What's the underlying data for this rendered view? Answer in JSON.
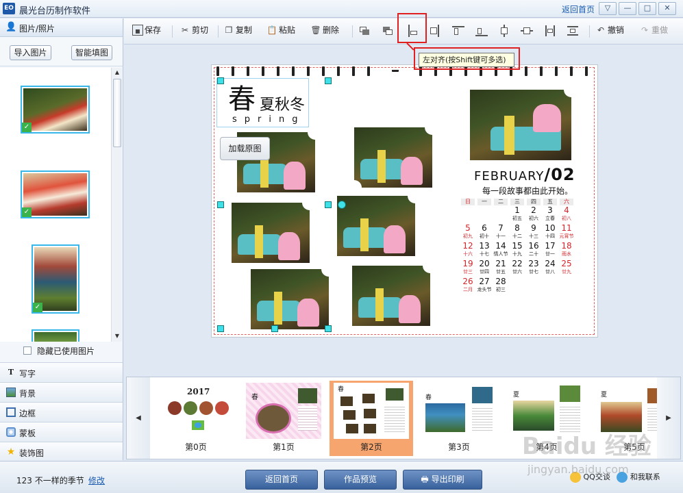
{
  "window": {
    "logo": "EO",
    "title": "晨光台历制作软件",
    "back_home": "返回首页",
    "menu_glyph": "▽",
    "minimize_glyph": "—",
    "maximize_glyph": "□",
    "close_glyph": "✕"
  },
  "sidebar": {
    "header_label": "图片/照片",
    "import_button": "导入图片",
    "smart_fill_button": "智能填图",
    "hide_used_label": "隐藏已使用图片",
    "tools": [
      {
        "label": "写字",
        "icon": "text-tool-icon"
      },
      {
        "label": "背景",
        "icon": "background-icon"
      },
      {
        "label": "边框",
        "icon": "border-icon"
      },
      {
        "label": "蒙板",
        "icon": "mask-icon"
      },
      {
        "label": "装饰图",
        "icon": "decoration-star-icon"
      }
    ]
  },
  "toolbar": {
    "save": "保存",
    "cut": "剪切",
    "copy": "复制",
    "paste": "粘贴",
    "delete": "删除",
    "undo": "撤销",
    "redo": "重做",
    "tooltip": "左对齐(按Shift键可多选)"
  },
  "calendar_page": {
    "title_big": "春",
    "title_rest": "夏秋冬",
    "title_en": "spring",
    "load_original": "加载原图",
    "month_title": "FEBRUARY",
    "month_num": "/02",
    "tagline": "每一段故事都由此开始。",
    "weekdays": [
      "日",
      "一",
      "二",
      "三",
      "四",
      "五",
      "六"
    ],
    "days": [
      {
        "n": "1",
        "l": "初五",
        "col": 3,
        "row": 0,
        "red": false
      },
      {
        "n": "2",
        "l": "初六",
        "col": 4,
        "row": 0,
        "red": false
      },
      {
        "n": "3",
        "l": "立春",
        "col": 5,
        "row": 0,
        "red": false
      },
      {
        "n": "4",
        "l": "初八",
        "col": 6,
        "row": 0,
        "red": true
      },
      {
        "n": "5",
        "l": "初九",
        "col": 0,
        "row": 1,
        "red": true
      },
      {
        "n": "6",
        "l": "初十",
        "col": 1,
        "row": 1,
        "red": false
      },
      {
        "n": "7",
        "l": "十一",
        "col": 2,
        "row": 1,
        "red": false
      },
      {
        "n": "8",
        "l": "十二",
        "col": 3,
        "row": 1,
        "red": false
      },
      {
        "n": "9",
        "l": "十三",
        "col": 4,
        "row": 1,
        "red": false
      },
      {
        "n": "10",
        "l": "十四",
        "col": 5,
        "row": 1,
        "red": false
      },
      {
        "n": "11",
        "l": "元宵节",
        "col": 6,
        "row": 1,
        "red": true
      },
      {
        "n": "12",
        "l": "十六",
        "col": 0,
        "row": 2,
        "red": true
      },
      {
        "n": "13",
        "l": "十七",
        "col": 1,
        "row": 2,
        "red": false
      },
      {
        "n": "14",
        "l": "情人节",
        "col": 2,
        "row": 2,
        "red": false
      },
      {
        "n": "15",
        "l": "十九",
        "col": 3,
        "row": 2,
        "red": false
      },
      {
        "n": "16",
        "l": "二十",
        "col": 4,
        "row": 2,
        "red": false
      },
      {
        "n": "17",
        "l": "廿一",
        "col": 5,
        "row": 2,
        "red": false
      },
      {
        "n": "18",
        "l": "雨水",
        "col": 6,
        "row": 2,
        "red": true
      },
      {
        "n": "19",
        "l": "廿三",
        "col": 0,
        "row": 3,
        "red": true
      },
      {
        "n": "20",
        "l": "廿四",
        "col": 1,
        "row": 3,
        "red": false
      },
      {
        "n": "21",
        "l": "廿五",
        "col": 2,
        "row": 3,
        "red": false
      },
      {
        "n": "22",
        "l": "廿六",
        "col": 3,
        "row": 3,
        "red": false
      },
      {
        "n": "23",
        "l": "廿七",
        "col": 4,
        "row": 3,
        "red": false
      },
      {
        "n": "24",
        "l": "廿八",
        "col": 5,
        "row": 3,
        "red": false
      },
      {
        "n": "25",
        "l": "廿九",
        "col": 6,
        "row": 3,
        "red": true
      },
      {
        "n": "26",
        "l": "二月",
        "col": 0,
        "row": 4,
        "red": true
      },
      {
        "n": "27",
        "l": "龙头节",
        "col": 1,
        "row": 4,
        "red": false
      },
      {
        "n": "28",
        "l": "初三",
        "col": 2,
        "row": 4,
        "red": false
      }
    ]
  },
  "page_strip": {
    "pages": [
      {
        "label": "第0页",
        "heading": "2017",
        "active": false
      },
      {
        "label": "第1页",
        "heading": "春",
        "active": false
      },
      {
        "label": "第2页",
        "heading": "春",
        "active": true
      },
      {
        "label": "第3页",
        "heading": "春",
        "active": false
      },
      {
        "label": "第4页",
        "heading": "夏",
        "active": false
      },
      {
        "label": "第5页",
        "heading": "夏",
        "active": false
      }
    ]
  },
  "bottombar": {
    "project_name": "123  不一样的季节",
    "rename": "修改",
    "back_home_button": "返回首页",
    "preview_button": "作品预览",
    "export_button": "导出印刷",
    "qq_label": "QQ交谈",
    "contact_label": "和我联系"
  },
  "watermark": {
    "brand": "Baidu 经验",
    "url": "jingyan.baidu.com"
  }
}
